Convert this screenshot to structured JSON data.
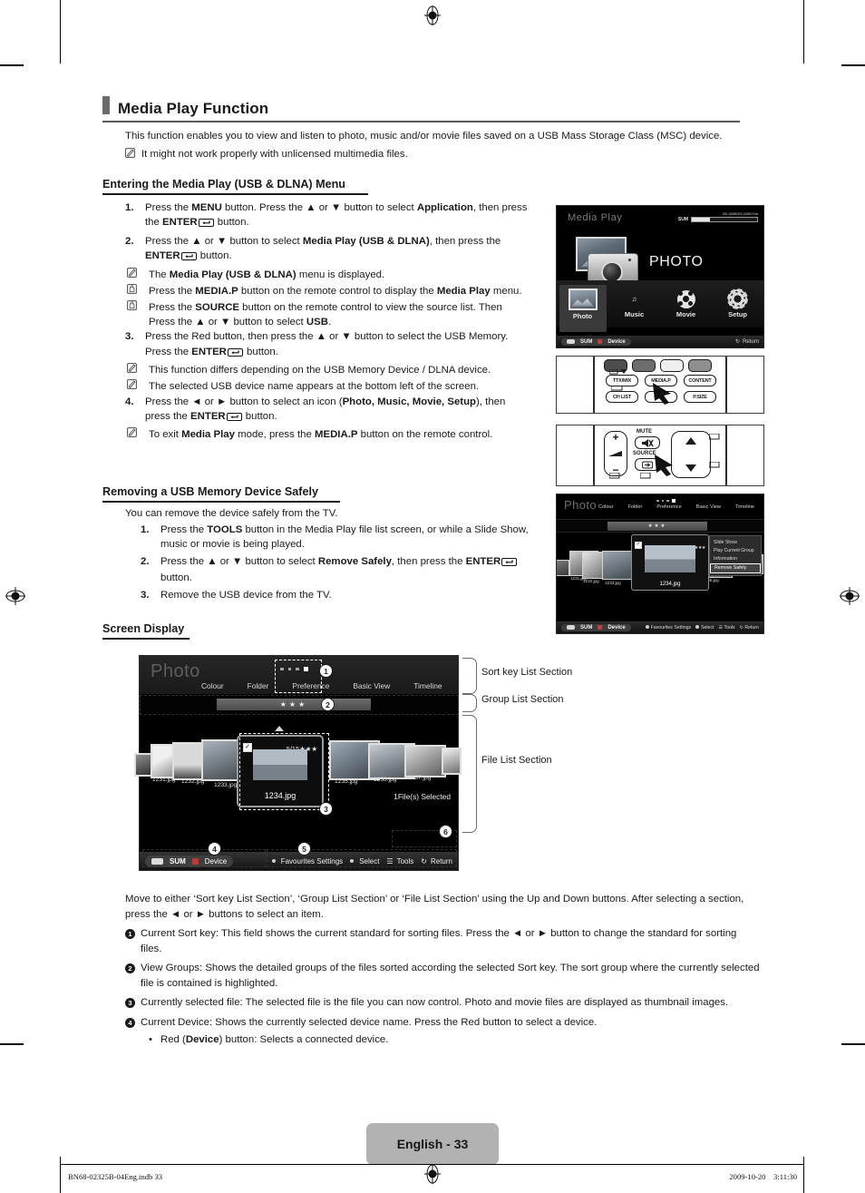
{
  "page": {
    "heading": "Media Play Function",
    "intro": "This function enables you to view and listen to photo, music and/or movie files saved on a USB Mass Storage Class (MSC) device.",
    "intro_note": "It might not work properly with unlicensed multimedia files.",
    "page_label": "English - 33",
    "footer_left": "BN68-02325B-04Eng.indb   33",
    "footer_right": "2009-10-20      3:11:30"
  },
  "section_entering": {
    "heading": "Entering the Media Play (USB & DLNA) Menu",
    "steps": [
      {
        "num": "1.",
        "parts": [
          {
            "t": "Press the ",
            "b": false
          },
          {
            "t": "MENU",
            "b": true
          },
          {
            "t": " button. Press the ▲ or ▼ button to select ",
            "b": false
          },
          {
            "t": "Application",
            "b": true
          },
          {
            "t": ", then press the ",
            "b": false
          },
          {
            "t": "ENTER",
            "b": true
          },
          {
            "t": "E",
            "icon": "enter"
          },
          {
            "t": " button.",
            "b": false
          }
        ],
        "subs": []
      },
      {
        "num": "2.",
        "parts": [
          {
            "t": "Press the ▲ or ▼ button to select ",
            "b": false
          },
          {
            "t": "Media Play (USB & DLNA)",
            "b": true
          },
          {
            "t": ", then press the ",
            "b": false
          },
          {
            "t": "ENTER",
            "b": true
          },
          {
            "t": "E",
            "icon": "enter"
          },
          {
            "t": " button.",
            "b": false
          }
        ],
        "subs": [
          {
            "icon": "note",
            "parts": [
              {
                "t": "The ",
                "b": false
              },
              {
                "t": "Media Play (USB & DLNA)",
                "b": true
              },
              {
                "t": " menu is displayed.",
                "b": false
              }
            ]
          },
          {
            "icon": "hand",
            "parts": [
              {
                "t": "Press the ",
                "b": false
              },
              {
                "t": "MEDIA.P",
                "b": true
              },
              {
                "t": " button on the remote control to display the ",
                "b": false
              },
              {
                "t": "Media Play",
                "b": true
              },
              {
                "t": " menu.",
                "b": false
              }
            ]
          },
          {
            "icon": "hand",
            "parts": [
              {
                "t": "Press the ",
                "b": false
              },
              {
                "t": "SOURCE",
                "b": true
              },
              {
                "t": " button on the remote control to view the source list. Then Press the ▲ or ▼ button to select ",
                "b": false
              },
              {
                "t": "USB",
                "b": true
              },
              {
                "t": ".",
                "b": false
              }
            ]
          }
        ]
      },
      {
        "num": "3.",
        "parts": [
          {
            "t": "Press the Red button, then press the ▲ or ▼ button to select the USB Memory. Press the ",
            "b": false
          },
          {
            "t": "ENTER",
            "b": true
          },
          {
            "t": "E",
            "icon": "enter"
          },
          {
            "t": " button.",
            "b": false
          }
        ],
        "subs": [
          {
            "icon": "note",
            "parts": [
              {
                "t": "This function differs depending on the USB Memory Device / DLNA device.",
                "b": false
              }
            ]
          },
          {
            "icon": "note",
            "parts": [
              {
                "t": "The selected USB device name appears at the bottom left of the screen.",
                "b": false
              }
            ]
          }
        ]
      },
      {
        "num": "4.",
        "parts": [
          {
            "t": "Press the ◄ or ► button to select an icon (",
            "b": false
          },
          {
            "t": "Photo, Music, Movie, Setup",
            "b": true
          },
          {
            "t": "), then press the ",
            "b": false
          },
          {
            "t": "ENTER",
            "b": true
          },
          {
            "t": "E",
            "icon": "enter"
          },
          {
            "t": " button.",
            "b": false
          }
        ],
        "subs": [
          {
            "icon": "note",
            "parts": [
              {
                "t": "To exit ",
                "b": false
              },
              {
                "t": "Media Play",
                "b": true
              },
              {
                "t": " mode, press the ",
                "b": false
              },
              {
                "t": "MEDIA.P",
                "b": true
              },
              {
                "t": " button on the remote control.",
                "b": false
              }
            ]
          }
        ]
      }
    ]
  },
  "section_removing": {
    "heading": "Removing a USB Memory Device Safely",
    "lead": "You can remove the device safely from the TV.",
    "steps": [
      {
        "num": "1.",
        "parts": [
          {
            "t": "Press the ",
            "b": false
          },
          {
            "t": "TOOLS",
            "b": true
          },
          {
            "t": " button in the Media Play file list screen, or while a Slide Show, music or movie is being played.",
            "b": false
          }
        ]
      },
      {
        "num": "2.",
        "parts": [
          {
            "t": "Press the ▲ or ▼ button to select ",
            "b": false
          },
          {
            "t": "Remove Safely",
            "b": true
          },
          {
            "t": ", then press the ",
            "b": false
          },
          {
            "t": "ENTER",
            "b": true
          },
          {
            "t": "E",
            "icon": "enter"
          },
          {
            "t": " button.",
            "b": false
          }
        ]
      },
      {
        "num": "3.",
        "parts": [
          {
            "t": "Remove the USB device from the TV.",
            "b": false
          }
        ]
      }
    ]
  },
  "section_screen_display": {
    "heading": "Screen Display",
    "section_labels": [
      "Sort key List Section",
      "Group List Section",
      "File List Section"
    ],
    "move_text": "Move to either ‘Sort key List Section’, ‘Group List Section’ or ‘File List Section’ using the Up and Down buttons. After selecting a section, press the ◄ or ► buttons to select an item.",
    "notes": [
      {
        "num": "1",
        "parts": [
          {
            "t": "Current Sort key: This field shows the current standard for sorting files. Press the ◄ or ► button to change the standard for sorting files.",
            "b": false
          }
        ]
      },
      {
        "num": "2",
        "parts": [
          {
            "t": "View Groups:  Shows the detailed groups of the files sorted according the selected Sort key. The sort group where the currently selected file is contained is highlighted.",
            "b": false
          }
        ]
      },
      {
        "num": "3",
        "parts": [
          {
            "t": "Currently selected file: The selected file is the file you can now control. Photo and movie files are displayed as thumbnail images.",
            "b": false
          }
        ]
      },
      {
        "num": "4",
        "parts": [
          {
            "t": "Current Device: Shows the currently selected device name. Press the Red button to select a device.",
            "b": false
          }
        ]
      }
    ],
    "bullet": [
      {
        "t": "Red (",
        "b": false
      },
      {
        "t": "Device",
        "b": true
      },
      {
        "t": ") button: Selects a connected device.",
        "b": false
      }
    ]
  },
  "tv_media_play": {
    "title": "Media Play",
    "device_label": "SUM",
    "capacity": "851.00MB/993.02MB Free",
    "big_label": "PHOTO",
    "icons": [
      {
        "label": "Photo",
        "icon": "photo-icon",
        "selected": true
      },
      {
        "label": "Music",
        "icon": "music-icon",
        "selected": false
      },
      {
        "label": "Movie",
        "icon": "movie-icon",
        "selected": false
      },
      {
        "label": "Setup",
        "icon": "setup-icon",
        "selected": false
      }
    ],
    "bottom_left_usb": "SUM",
    "bottom_left_device": "Device",
    "bottom_right_return": "Return"
  },
  "remote_top": {
    "buttons_row1": [
      "TTX/MIX",
      "MEDIA.P",
      "CONTENT"
    ],
    "buttons_row2": [
      "CH LIST",
      "AD",
      "P.SIZE"
    ]
  },
  "remote_bottom": {
    "mute_label": "MUTE",
    "source_label": "SOURCE",
    "vol_plus": "+",
    "vol_minus": "−"
  },
  "tv_file_list": {
    "title": "Photo",
    "tabs": [
      "Colour",
      "Folder",
      "Preference",
      "Basic View",
      "Timeline"
    ],
    "group_stars": "★★★",
    "thumbs": [
      {
        "name": "1231.jpg"
      },
      {
        "name": "1232.jpg"
      },
      {
        "name": "1233.jpg"
      },
      {
        "name": "1235.jpg"
      }
    ],
    "card": {
      "counter": "5/15",
      "stars": "★★★",
      "name": "1234.jpg"
    },
    "menu": [
      "Slide Show",
      "Play Current Group",
      "Information",
      "Remove Safely"
    ],
    "menu_selected": "Remove Safely",
    "bottom": {
      "usb": "SUM",
      "device": "Device",
      "favourites": "Favourites Settings",
      "select": "Select",
      "tools": "Tools",
      "return": "Return"
    }
  },
  "diagram": {
    "title": "Photo",
    "tabs": [
      "Colour",
      "Folder",
      "Preference",
      "Basic View",
      "Timeline"
    ],
    "group_stars": "★★★",
    "thumbs_left": [
      {
        "name": "1231.jpg"
      },
      {
        "name": "1232.jpg"
      },
      {
        "name": "1233.jpg"
      }
    ],
    "thumbs_right": [
      {
        "name": "1235.jpg"
      },
      {
        "name": "1236.jpg"
      },
      {
        "name": "1237.jpg"
      }
    ],
    "card": {
      "counter": "5/15",
      "stars": "★★★",
      "name": "1234.jpg"
    },
    "files_selected": "1File(s) Selected",
    "bottom": {
      "usb": "SUM",
      "device": "Device",
      "favourites": "Favourites Settings",
      "select": "Select",
      "tools": "Tools",
      "return": "Return"
    },
    "badges": [
      "1",
      "2",
      "3",
      "4",
      "5",
      "6"
    ]
  }
}
